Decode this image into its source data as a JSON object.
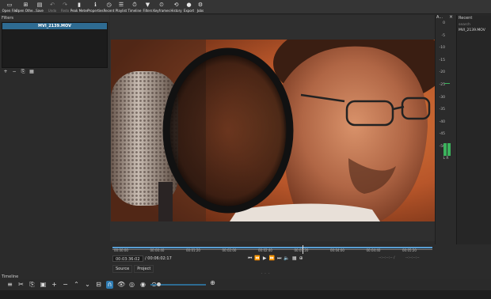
{
  "toolbar": {
    "items": [
      {
        "label": "Open File",
        "icon": "open-file-icon",
        "enabled": true
      },
      {
        "label": "Open Othe...",
        "icon": "open-other-icon",
        "enabled": true
      },
      {
        "label": "Save",
        "icon": "save-icon",
        "enabled": true
      },
      {
        "label": "Undo",
        "icon": "undo-icon",
        "enabled": false
      },
      {
        "label": "Redo",
        "icon": "redo-icon",
        "enabled": false
      },
      {
        "label": "Peak Meter",
        "icon": "peak-meter-icon",
        "enabled": true
      },
      {
        "label": "Properties",
        "icon": "properties-icon",
        "enabled": true
      },
      {
        "label": "Recent",
        "icon": "recent-icon",
        "enabled": true
      },
      {
        "label": "Playlist",
        "icon": "playlist-icon",
        "enabled": true
      },
      {
        "label": "Timeline",
        "icon": "timeline-icon",
        "enabled": true
      },
      {
        "label": "Filters",
        "icon": "filters-icon",
        "enabled": true
      },
      {
        "label": "Keyframes",
        "icon": "keyframes-icon",
        "enabled": true
      },
      {
        "label": "History",
        "icon": "history-icon",
        "enabled": true
      },
      {
        "label": "Export",
        "icon": "export-icon",
        "enabled": true
      },
      {
        "label": "Jobs",
        "icon": "jobs-icon",
        "enabled": true
      }
    ]
  },
  "filters": {
    "title": "Filters",
    "clip_name": "MVI_2139.MOV",
    "buttons": [
      "+",
      "−",
      "⎘",
      "▦"
    ]
  },
  "meter": {
    "title": "A...",
    "close": "×",
    "scale": [
      "0",
      "-5",
      "-10",
      "-15",
      "-20",
      "-25",
      "-30",
      "-35",
      "-40",
      "-45",
      "-50"
    ],
    "channels": "L R",
    "level_db": -50
  },
  "recent": {
    "title": "Recent",
    "search_placeholder": "search",
    "items": [
      "MVI_2139.MOV"
    ]
  },
  "player": {
    "scrub_labels": [
      "00:00:00",
      "00:00:40",
      "00:01:20",
      "00:02:00",
      "00:02:40",
      "00:03:20",
      "00:04:00",
      "00:04:40",
      "00:05:20"
    ],
    "position": "00:03:36:02",
    "duration": "/ 00:06:02:17",
    "in_out": "--:--:--:-- /",
    "in_out_2": "--:--:--:--",
    "tabs": [
      "Source",
      "Project"
    ]
  },
  "timeline": {
    "title": "Timeline",
    "menu": "≡"
  }
}
